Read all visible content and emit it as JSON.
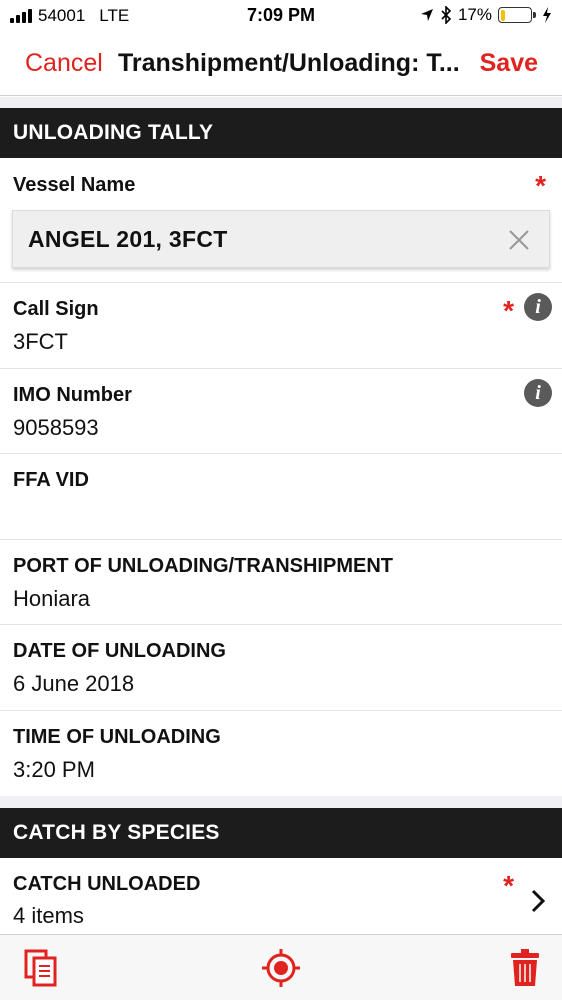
{
  "status_bar": {
    "carrier": "54001",
    "network": "LTE",
    "time": "7:09 PM",
    "battery_percent": "17%",
    "battery_level": 0.17
  },
  "nav": {
    "cancel_label": "Cancel",
    "title": "Transhipment/Unloading: T...",
    "save_label": "Save"
  },
  "sections": {
    "unloading_tally": "UNLOADING TALLY",
    "catch_by_species": "CATCH BY SPECIES"
  },
  "fields": {
    "vessel_name": {
      "label": "Vessel Name",
      "value": "ANGEL 201, 3FCT",
      "required_mark": "*"
    },
    "call_sign": {
      "label": "Call Sign",
      "value": "3FCT",
      "required_mark": "*",
      "info": "i"
    },
    "imo_number": {
      "label": "IMO Number",
      "value": "9058593",
      "info": "i"
    },
    "ffa_vid": {
      "label": "FFA VID",
      "value": ""
    },
    "port": {
      "label": "PORT OF UNLOADING/TRANSHIPMENT",
      "value": "Honiara"
    },
    "date": {
      "label": "DATE OF UNLOADING",
      "value": "6 June 2018"
    },
    "time": {
      "label": "TIME OF UNLOADING",
      "value": "3:20 PM"
    },
    "catch_unloaded": {
      "label": "CATCH UNLOADED",
      "value": "4 items",
      "required_mark": "*",
      "chevron": "›"
    }
  },
  "toolbar": {
    "icons": [
      "copy-document-icon",
      "location-target-icon",
      "trash-icon"
    ]
  },
  "colors": {
    "accent": "#e0231f",
    "section_header_bg": "#1c1c1c",
    "info_icon": "#5a5a5a",
    "battery": "#f2c200"
  }
}
